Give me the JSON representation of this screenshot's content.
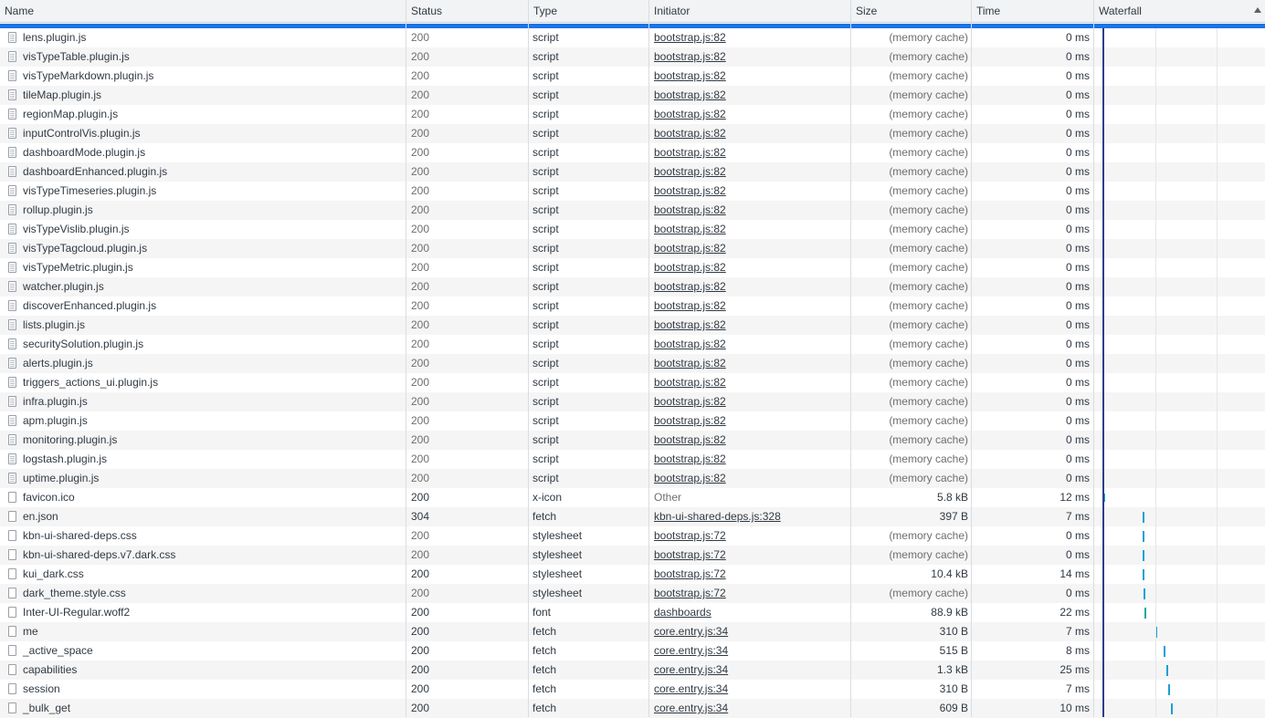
{
  "columns": {
    "name": "Name",
    "status": "Status",
    "type": "Type",
    "initiator": "Initiator",
    "size": "Size",
    "time": "Time",
    "waterfall": "Waterfall"
  },
  "colors": {
    "selection": "#1a73e8",
    "waterfall_bar": "#1a9fd6",
    "waterfall_bar_font": "#13a89e",
    "dom_marker": "#2f3d8c"
  },
  "rows": [
    {
      "name": "lens.plugin.js",
      "status": "200",
      "type": "script",
      "initiator": "bootstrap.js:82",
      "initiator_link": true,
      "size": "(memory cache)",
      "time": "0 ms"
    },
    {
      "name": "visTypeTable.plugin.js",
      "status": "200",
      "type": "script",
      "initiator": "bootstrap.js:82",
      "initiator_link": true,
      "size": "(memory cache)",
      "time": "0 ms"
    },
    {
      "name": "visTypeMarkdown.plugin.js",
      "status": "200",
      "type": "script",
      "initiator": "bootstrap.js:82",
      "initiator_link": true,
      "size": "(memory cache)",
      "time": "0 ms"
    },
    {
      "name": "tileMap.plugin.js",
      "status": "200",
      "type": "script",
      "initiator": "bootstrap.js:82",
      "initiator_link": true,
      "size": "(memory cache)",
      "time": "0 ms"
    },
    {
      "name": "regionMap.plugin.js",
      "status": "200",
      "type": "script",
      "initiator": "bootstrap.js:82",
      "initiator_link": true,
      "size": "(memory cache)",
      "time": "0 ms"
    },
    {
      "name": "inputControlVis.plugin.js",
      "status": "200",
      "type": "script",
      "initiator": "bootstrap.js:82",
      "initiator_link": true,
      "size": "(memory cache)",
      "time": "0 ms"
    },
    {
      "name": "dashboardMode.plugin.js",
      "status": "200",
      "type": "script",
      "initiator": "bootstrap.js:82",
      "initiator_link": true,
      "size": "(memory cache)",
      "time": "0 ms"
    },
    {
      "name": "dashboardEnhanced.plugin.js",
      "status": "200",
      "type": "script",
      "initiator": "bootstrap.js:82",
      "initiator_link": true,
      "size": "(memory cache)",
      "time": "0 ms"
    },
    {
      "name": "visTypeTimeseries.plugin.js",
      "status": "200",
      "type": "script",
      "initiator": "bootstrap.js:82",
      "initiator_link": true,
      "size": "(memory cache)",
      "time": "0 ms"
    },
    {
      "name": "rollup.plugin.js",
      "status": "200",
      "type": "script",
      "initiator": "bootstrap.js:82",
      "initiator_link": true,
      "size": "(memory cache)",
      "time": "0 ms"
    },
    {
      "name": "visTypeVislib.plugin.js",
      "status": "200",
      "type": "script",
      "initiator": "bootstrap.js:82",
      "initiator_link": true,
      "size": "(memory cache)",
      "time": "0 ms"
    },
    {
      "name": "visTypeTagcloud.plugin.js",
      "status": "200",
      "type": "script",
      "initiator": "bootstrap.js:82",
      "initiator_link": true,
      "size": "(memory cache)",
      "time": "0 ms"
    },
    {
      "name": "visTypeMetric.plugin.js",
      "status": "200",
      "type": "script",
      "initiator": "bootstrap.js:82",
      "initiator_link": true,
      "size": "(memory cache)",
      "time": "0 ms"
    },
    {
      "name": "watcher.plugin.js",
      "status": "200",
      "type": "script",
      "initiator": "bootstrap.js:82",
      "initiator_link": true,
      "size": "(memory cache)",
      "time": "0 ms"
    },
    {
      "name": "discoverEnhanced.plugin.js",
      "status": "200",
      "type": "script",
      "initiator": "bootstrap.js:82",
      "initiator_link": true,
      "size": "(memory cache)",
      "time": "0 ms"
    },
    {
      "name": "lists.plugin.js",
      "status": "200",
      "type": "script",
      "initiator": "bootstrap.js:82",
      "initiator_link": true,
      "size": "(memory cache)",
      "time": "0 ms"
    },
    {
      "name": "securitySolution.plugin.js",
      "status": "200",
      "type": "script",
      "initiator": "bootstrap.js:82",
      "initiator_link": true,
      "size": "(memory cache)",
      "time": "0 ms"
    },
    {
      "name": "alerts.plugin.js",
      "status": "200",
      "type": "script",
      "initiator": "bootstrap.js:82",
      "initiator_link": true,
      "size": "(memory cache)",
      "time": "0 ms"
    },
    {
      "name": "triggers_actions_ui.plugin.js",
      "status": "200",
      "type": "script",
      "initiator": "bootstrap.js:82",
      "initiator_link": true,
      "size": "(memory cache)",
      "time": "0 ms"
    },
    {
      "name": "infra.plugin.js",
      "status": "200",
      "type": "script",
      "initiator": "bootstrap.js:82",
      "initiator_link": true,
      "size": "(memory cache)",
      "time": "0 ms"
    },
    {
      "name": "apm.plugin.js",
      "status": "200",
      "type": "script",
      "initiator": "bootstrap.js:82",
      "initiator_link": true,
      "size": "(memory cache)",
      "time": "0 ms"
    },
    {
      "name": "monitoring.plugin.js",
      "status": "200",
      "type": "script",
      "initiator": "bootstrap.js:82",
      "initiator_link": true,
      "size": "(memory cache)",
      "time": "0 ms"
    },
    {
      "name": "logstash.plugin.js",
      "status": "200",
      "type": "script",
      "initiator": "bootstrap.js:82",
      "initiator_link": true,
      "size": "(memory cache)",
      "time": "0 ms"
    },
    {
      "name": "uptime.plugin.js",
      "status": "200",
      "type": "script",
      "initiator": "bootstrap.js:82",
      "initiator_link": true,
      "size": "(memory cache)",
      "time": "0 ms"
    },
    {
      "name": "favicon.ico",
      "status": "200",
      "type": "x-icon",
      "initiator": "Other",
      "initiator_link": false,
      "size": "5.8 kB",
      "time": "12 ms"
    },
    {
      "name": "en.json",
      "status": "304",
      "type": "fetch",
      "initiator": "kbn-ui-shared-deps.js:328",
      "initiator_link": true,
      "size": "397 B",
      "time": "7 ms"
    },
    {
      "name": "kbn-ui-shared-deps.css",
      "status": "200",
      "type": "stylesheet",
      "initiator": "bootstrap.js:72",
      "initiator_link": true,
      "size": "(memory cache)",
      "time": "0 ms"
    },
    {
      "name": "kbn-ui-shared-deps.v7.dark.css",
      "status": "200",
      "type": "stylesheet",
      "initiator": "bootstrap.js:72",
      "initiator_link": true,
      "size": "(memory cache)",
      "time": "0 ms"
    },
    {
      "name": "kui_dark.css",
      "status": "200",
      "type": "stylesheet",
      "initiator": "bootstrap.js:72",
      "initiator_link": true,
      "size": "10.4 kB",
      "time": "14 ms"
    },
    {
      "name": "dark_theme.style.css",
      "status": "200",
      "type": "stylesheet",
      "initiator": "bootstrap.js:72",
      "initiator_link": true,
      "size": "(memory cache)",
      "time": "0 ms"
    },
    {
      "name": "Inter-UI-Regular.woff2",
      "status": "200",
      "type": "font",
      "initiator": "dashboards",
      "initiator_link": true,
      "size": "88.9 kB",
      "time": "22 ms"
    },
    {
      "name": "me",
      "status": "200",
      "type": "fetch",
      "initiator": "core.entry.js:34",
      "initiator_link": true,
      "size": "310 B",
      "time": "7 ms"
    },
    {
      "name": "_active_space",
      "status": "200",
      "type": "fetch",
      "initiator": "core.entry.js:34",
      "initiator_link": true,
      "size": "515 B",
      "time": "8 ms"
    },
    {
      "name": "capabilities",
      "status": "200",
      "type": "fetch",
      "initiator": "core.entry.js:34",
      "initiator_link": true,
      "size": "1.3 kB",
      "time": "25 ms"
    },
    {
      "name": "session",
      "status": "200",
      "type": "fetch",
      "initiator": "core.entry.js:34",
      "initiator_link": true,
      "size": "310 B",
      "time": "7 ms"
    },
    {
      "name": "_bulk_get",
      "status": "200",
      "type": "fetch",
      "initiator": "core.entry.js:34",
      "initiator_link": true,
      "size": "609 B",
      "time": "10 ms"
    }
  ]
}
